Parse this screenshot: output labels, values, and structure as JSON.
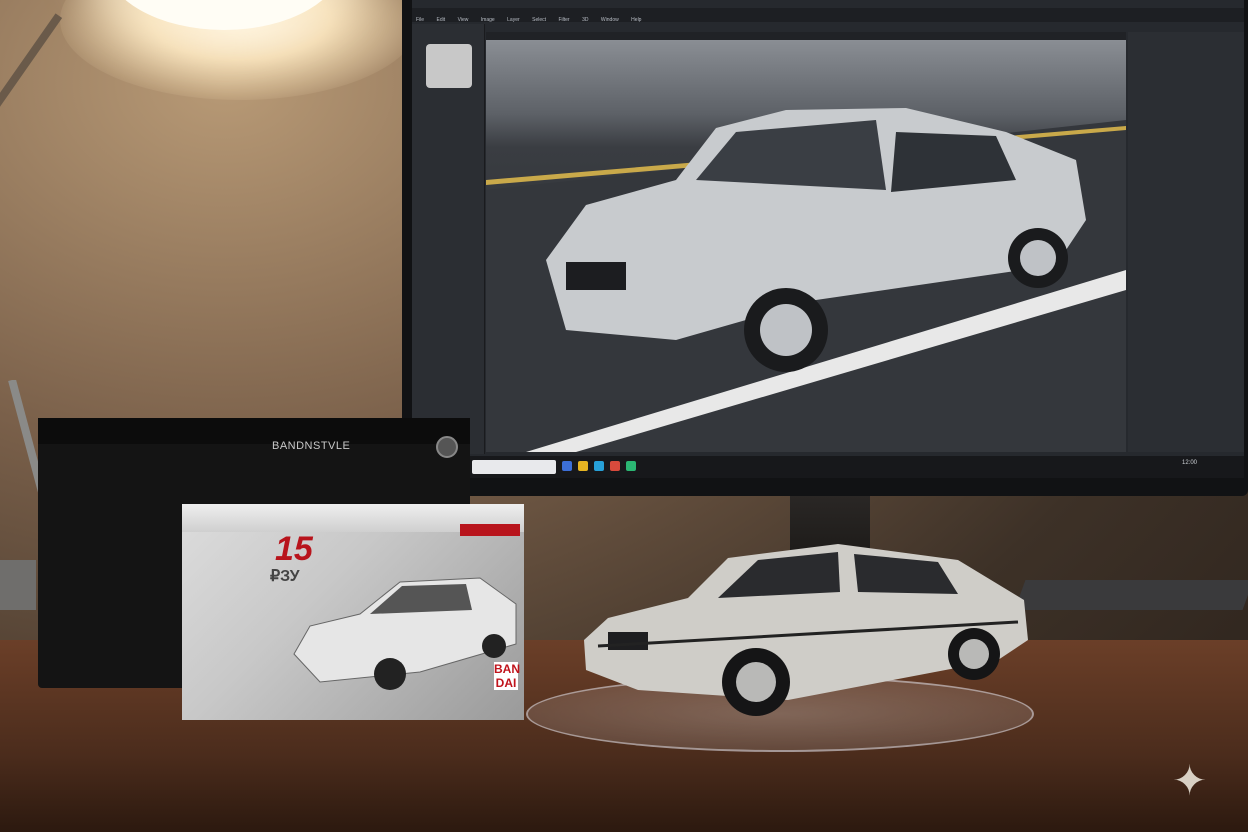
{
  "printer": {
    "label": "BANDNSTVLE"
  },
  "kit_box": {
    "title": "15",
    "subtitle": "₽ЗУ",
    "brand": "BAN DAI"
  },
  "screen": {
    "menu_items": [
      "File",
      "Edit",
      "View",
      "Image",
      "Layer",
      "Select",
      "Filter",
      "3D",
      "Window",
      "Help"
    ],
    "clock": "12:00"
  }
}
